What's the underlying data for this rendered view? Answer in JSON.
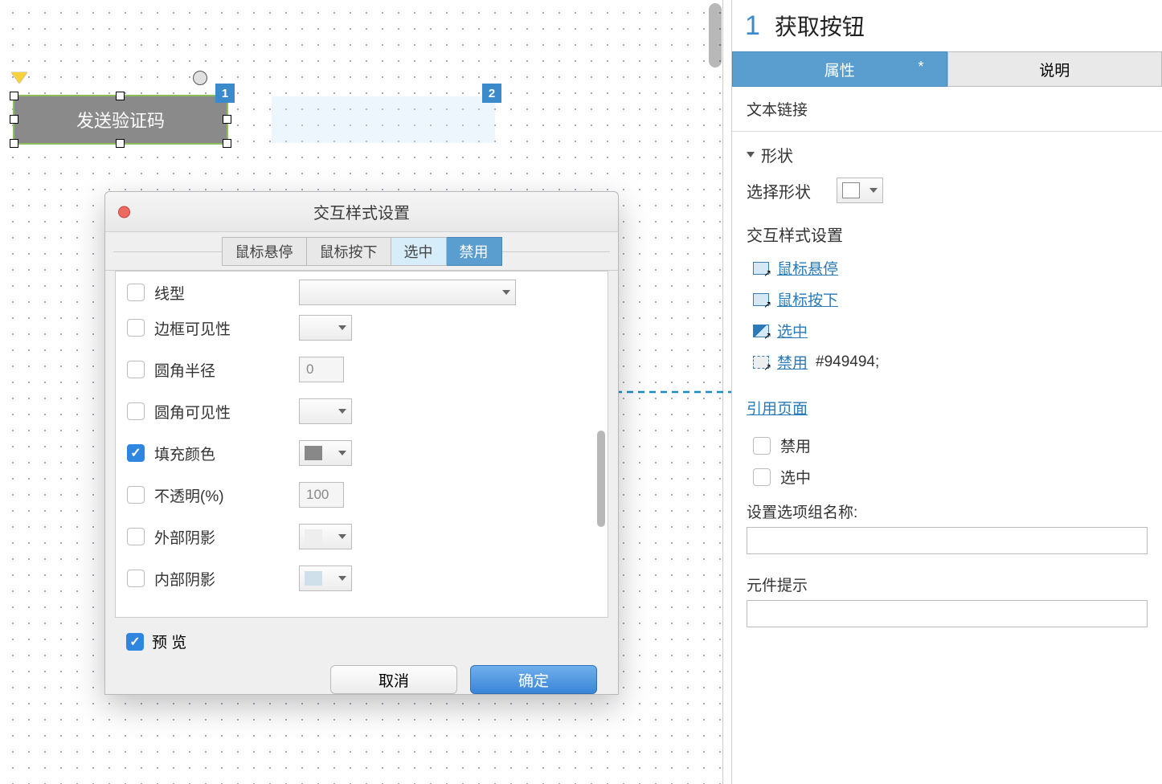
{
  "canvas": {
    "selected_widget_text": "发送验证码",
    "badge1": "1",
    "badge2": "2"
  },
  "dialog": {
    "title": "交互样式设置",
    "tabs": {
      "hover": "鼠标悬停",
      "mousedown": "鼠标按下",
      "selected": "选中",
      "disabled": "禁用"
    },
    "props": {
      "line_style": "线型",
      "border_visible": "边框可见性",
      "corner_radius": "圆角半径",
      "corner_radius_value": "0",
      "corner_visible": "圆角可见性",
      "fill_color": "填充颜色",
      "opacity": "不透明(%)",
      "opacity_value": "100",
      "outer_shadow": "外部阴影",
      "inner_shadow": "内部阴影"
    },
    "preview": "预 览",
    "cancel": "取消",
    "ok": "确定"
  },
  "panel": {
    "number": "1",
    "title": "获取按钮",
    "tab_props": "属性",
    "tab_notes": "说明",
    "dirty_mark": "*",
    "text_link": "文本链接",
    "shape_section": "形状",
    "select_shape": "选择形状",
    "interaction_styles": "交互样式设置",
    "link_hover": "鼠标悬停",
    "link_mousedown": "鼠标按下",
    "link_selected": "选中",
    "link_disabled": "禁用",
    "disabled_color": "#949494;",
    "reference_page": "引用页面",
    "cb_disabled": "禁用",
    "cb_selected": "选中",
    "group_name_label": "设置选项组名称:",
    "tooltip_label": "元件提示"
  }
}
